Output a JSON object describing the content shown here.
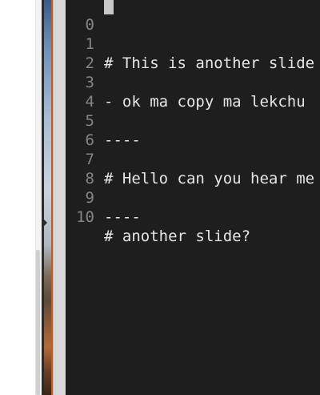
{
  "editor": {
    "lines": [
      {
        "number": "0",
        "text": ""
      },
      {
        "number": "1",
        "text": "# This is another slide"
      },
      {
        "number": "2",
        "text": ""
      },
      {
        "number": "3",
        "text": "- ok ma copy ma lekchu"
      },
      {
        "number": "4",
        "text": ""
      },
      {
        "number": "5",
        "text": "----"
      },
      {
        "number": "6",
        "text": ""
      },
      {
        "number": "7",
        "text": "# Hello can you hear me"
      },
      {
        "number": "8",
        "text": ""
      },
      {
        "number": "9",
        "text": "----"
      },
      {
        "number": "10",
        "text": "# another slide?"
      }
    ]
  }
}
